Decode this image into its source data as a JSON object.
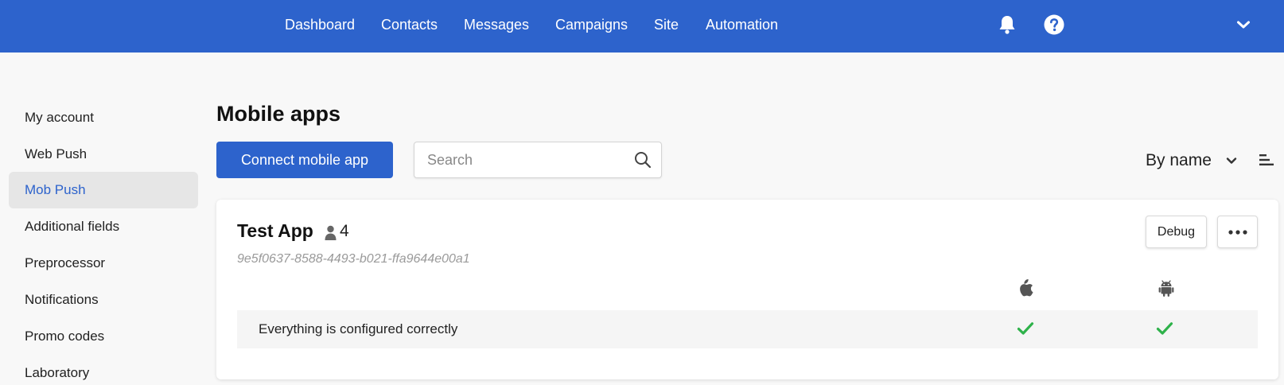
{
  "nav": {
    "items": [
      {
        "label": "Dashboard"
      },
      {
        "label": "Contacts"
      },
      {
        "label": "Messages"
      },
      {
        "label": "Campaigns"
      },
      {
        "label": "Site"
      },
      {
        "label": "Automation"
      }
    ],
    "icons": [
      "bell-icon",
      "help-icon",
      "chevron-down-icon"
    ]
  },
  "sidebar": {
    "items": [
      {
        "label": "My account",
        "active": false
      },
      {
        "label": "Web Push",
        "active": false
      },
      {
        "label": "Mob Push",
        "active": true
      },
      {
        "label": "Additional fields",
        "active": false
      },
      {
        "label": "Preprocessor",
        "active": false
      },
      {
        "label": "Notifications",
        "active": false
      },
      {
        "label": "Promo codes",
        "active": false
      },
      {
        "label": "Laboratory",
        "active": false
      }
    ]
  },
  "main": {
    "title": "Mobile apps",
    "connect_button": "Connect mobile app",
    "search": {
      "placeholder": "Search",
      "value": ""
    },
    "sort": {
      "label": "By name"
    }
  },
  "app": {
    "name": "Test App",
    "user_count": "4",
    "id": "9e5f0637-8588-4493-b021-ffa9644e00a1",
    "debug_label": "Debug",
    "status_text": "Everything is configured correctly",
    "platforms": [
      {
        "icon": "apple-icon",
        "status": "ok"
      },
      {
        "icon": "android-icon",
        "status": "ok"
      }
    ]
  },
  "colors": {
    "primary": "#2d63cc",
    "success": "#2eb24a",
    "sidebar_active_bg": "#e6e6e6"
  }
}
